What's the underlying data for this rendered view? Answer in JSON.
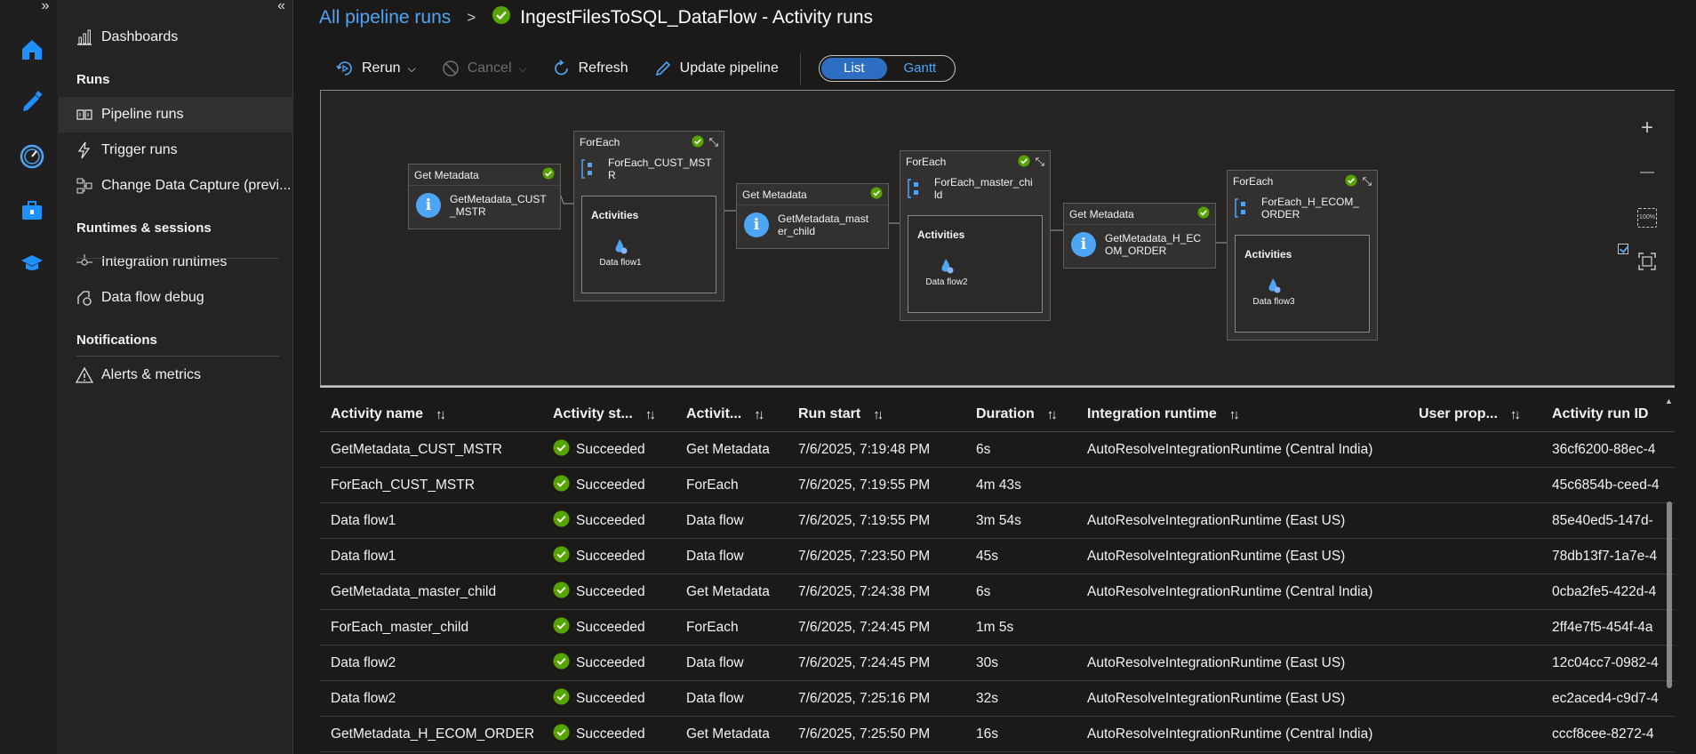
{
  "app": {
    "rail_icons": [
      "home-icon",
      "pencil-author-icon",
      "monitor-gauge-icon",
      "toolbox-manage-icon",
      "graduation-cap-learn-icon"
    ]
  },
  "sidenav": {
    "dashboards": "Dashboards",
    "runs_section": "Runs",
    "pipeline_runs": "Pipeline runs",
    "trigger_runs": "Trigger runs",
    "change_data_capture": "Change Data Capture (previ...",
    "runtimes_section": "Runtimes & sessions",
    "integration_runtimes": "Integration runtimes",
    "data_flow_debug": "Data flow debug",
    "notifications_section": "Notifications",
    "alerts_metrics": "Alerts & metrics"
  },
  "breadcrumb": {
    "parent": "All pipeline runs",
    "separator": ">",
    "title": "IngestFilesToSQL_DataFlow - Activity runs"
  },
  "toolbar": {
    "rerun": "Rerun",
    "cancel": "Cancel",
    "refresh": "Refresh",
    "update_pipeline": "Update pipeline",
    "view_list": "List",
    "view_gantt": "Gantt"
  },
  "canvas": {
    "activities": [
      {
        "type": "Get Metadata",
        "name_line1": "GetMetadata_CUST",
        "name_line2": "_MSTR"
      },
      {
        "type": "ForEach",
        "name_line1": "ForEach_CUST_MST",
        "name_line2": "R",
        "inner_label": "Activities",
        "inner_item": "Data flow1"
      },
      {
        "type": "Get Metadata",
        "name_line1": "GetMetadata_mast",
        "name_line2": "er_child"
      },
      {
        "type": "ForEach",
        "name_line1": "ForEach_master_chi",
        "name_line2": "ld",
        "inner_label": "Activities",
        "inner_item": "Data flow2"
      },
      {
        "type": "Get Metadata",
        "name_line1": "GetMetadata_H_EC",
        "name_line2": "OM_ORDER"
      },
      {
        "type": "ForEach",
        "name_line1": "ForEach_H_ECOM_",
        "name_line2": "ORDER",
        "inner_label": "Activities",
        "inner_item": "Data flow3"
      }
    ],
    "zoom_in": "+",
    "zoom_out": "—",
    "zoom_100": "100%"
  },
  "table": {
    "columns": [
      "Activity name",
      "Activity st...",
      "Activit...",
      "Run start",
      "Duration",
      "Integration runtime",
      "User prop...",
      "Activity run ID"
    ],
    "rows": [
      {
        "name": "GetMetadata_CUST_MSTR",
        "status": "Succeeded",
        "type": "Get Metadata",
        "start": "7/6/2025, 7:19:48 PM",
        "duration": "6s",
        "runtime": "AutoResolveIntegrationRuntime (Central India)",
        "runid": "36cf6200-88ec-4"
      },
      {
        "name": "ForEach_CUST_MSTR",
        "status": "Succeeded",
        "type": "ForEach",
        "start": "7/6/2025, 7:19:55 PM",
        "duration": "4m 43s",
        "runtime": "",
        "runid": "45c6854b-ceed-4"
      },
      {
        "name": "Data flow1",
        "status": "Succeeded",
        "type": "Data flow",
        "start": "7/6/2025, 7:19:55 PM",
        "duration": "3m 54s",
        "runtime": "AutoResolveIntegrationRuntime (East US)",
        "runid": "85e40ed5-147d-"
      },
      {
        "name": "Data flow1",
        "status": "Succeeded",
        "type": "Data flow",
        "start": "7/6/2025, 7:23:50 PM",
        "duration": "45s",
        "runtime": "AutoResolveIntegrationRuntime (East US)",
        "runid": "78db13f7-1a7e-4"
      },
      {
        "name": "GetMetadata_master_child",
        "status": "Succeeded",
        "type": "Get Metadata",
        "start": "7/6/2025, 7:24:38 PM",
        "duration": "6s",
        "runtime": "AutoResolveIntegrationRuntime (Central India)",
        "runid": "0cba2fe5-422d-4"
      },
      {
        "name": "ForEach_master_child",
        "status": "Succeeded",
        "type": "ForEach",
        "start": "7/6/2025, 7:24:45 PM",
        "duration": "1m 5s",
        "runtime": "",
        "runid": "2ff4e7f5-454f-4a"
      },
      {
        "name": "Data flow2",
        "status": "Succeeded",
        "type": "Data flow",
        "start": "7/6/2025, 7:24:45 PM",
        "duration": "30s",
        "runtime": "AutoResolveIntegrationRuntime (East US)",
        "runid": "12c04cc7-0982-4"
      },
      {
        "name": "Data flow2",
        "status": "Succeeded",
        "type": "Data flow",
        "start": "7/6/2025, 7:25:16 PM",
        "duration": "32s",
        "runtime": "AutoResolveIntegrationRuntime (East US)",
        "runid": "ec2aced4-c9d7-4"
      },
      {
        "name": "GetMetadata_H_ECOM_ORDER",
        "status": "Succeeded",
        "type": "Get Metadata",
        "start": "7/6/2025, 7:25:50 PM",
        "duration": "16s",
        "runtime": "AutoResolveIntegrationRuntime (Central India)",
        "runid": "cccf8cee-8272-4"
      }
    ]
  },
  "colors": {
    "accent": "#4ea5f6",
    "success": "#57a300",
    "background": "#1b1a19"
  }
}
